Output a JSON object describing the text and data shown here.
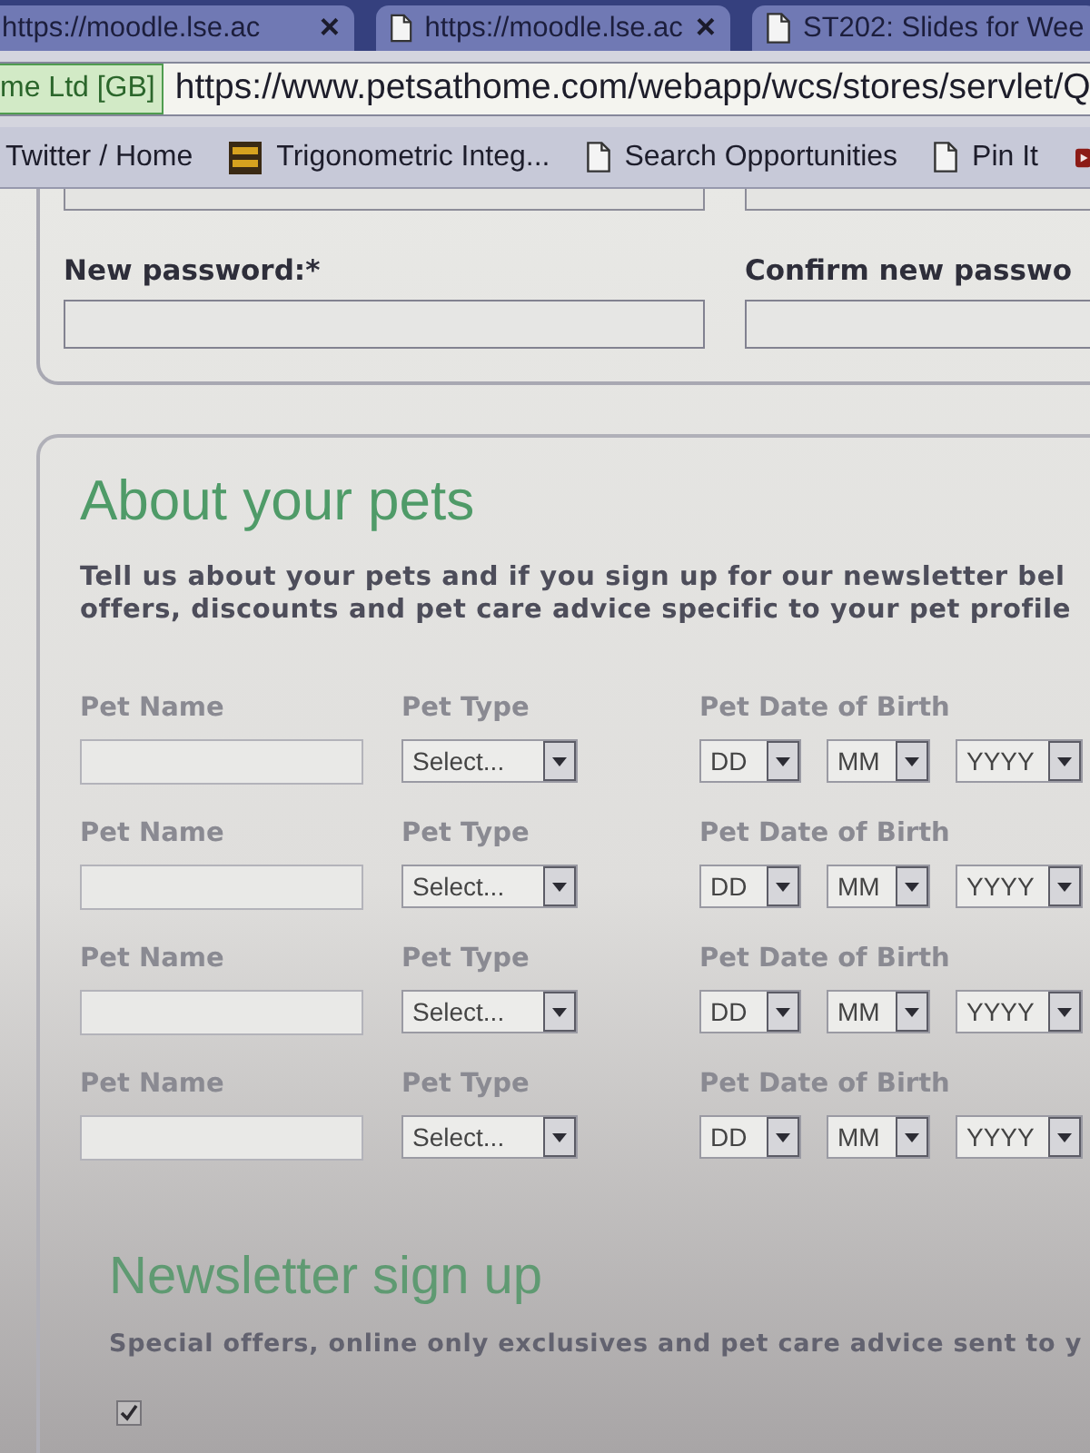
{
  "browser": {
    "tabs": [
      {
        "title": "https://moodle.lse.ac",
        "page_icon": false,
        "close": "×",
        "selected": false
      },
      {
        "title": "https://moodle.lse.ac",
        "page_icon": true,
        "close": "×",
        "selected": false
      },
      {
        "title": "ST202: Slides for Wee",
        "page_icon": true,
        "selected": false
      }
    ],
    "address": {
      "identity": "me Ltd [GB]",
      "url": "https://www.petsathome.com/webapp/wcs/stores/servlet/Q"
    },
    "bookmarks": [
      {
        "kind": "text",
        "label": "Twitter / Home"
      },
      {
        "kind": "site",
        "label": "Trigonometric Integ..."
      },
      {
        "kind": "page",
        "label": "Search Opportunities"
      },
      {
        "kind": "page",
        "label": "Pin It"
      },
      {
        "kind": "play"
      }
    ]
  },
  "account": {
    "fields_above": [
      {
        "kind": "input"
      },
      {
        "kind": "input"
      }
    ],
    "fields": [
      {
        "label": "New password:*"
      },
      {
        "label": "Confirm new passwo"
      }
    ]
  },
  "pets_section": {
    "title": "About your pets",
    "intro_lines": [
      "Tell us about your pets and if you sign up for our newsletter bel",
      "offers, discounts and pet care advice specific to your pet profile"
    ],
    "pets": [
      {
        "name_label": "Pet Name",
        "type_label": "Pet Type",
        "dob_label": "Pet Date of Birth",
        "type": "Select...",
        "day": "DD",
        "month": "MM",
        "year": "YYYY"
      },
      {
        "name_label": "Pet Name",
        "type_label": "Pet Type",
        "dob_label": "Pet Date of Birth",
        "type": "Select...",
        "day": "DD",
        "month": "MM",
        "year": "YYYY"
      },
      {
        "name_label": "Pet Name",
        "type_label": "Pet Type",
        "dob_label": "Pet Date of Birth",
        "type": "Select...",
        "day": "DD",
        "month": "MM",
        "year": "YYYY"
      },
      {
        "name_label": "Pet Name",
        "type_label": "Pet Type",
        "dob_label": "Pet Date of Birth",
        "type": "Select...",
        "day": "DD",
        "month": "MM",
        "year": "YYYY"
      }
    ]
  },
  "newsletter": {
    "title": "Newsletter sign up",
    "text": "Special offers, online only exclusives and pet care advice sent to y",
    "opt_in": {
      "checked": true
    }
  }
}
